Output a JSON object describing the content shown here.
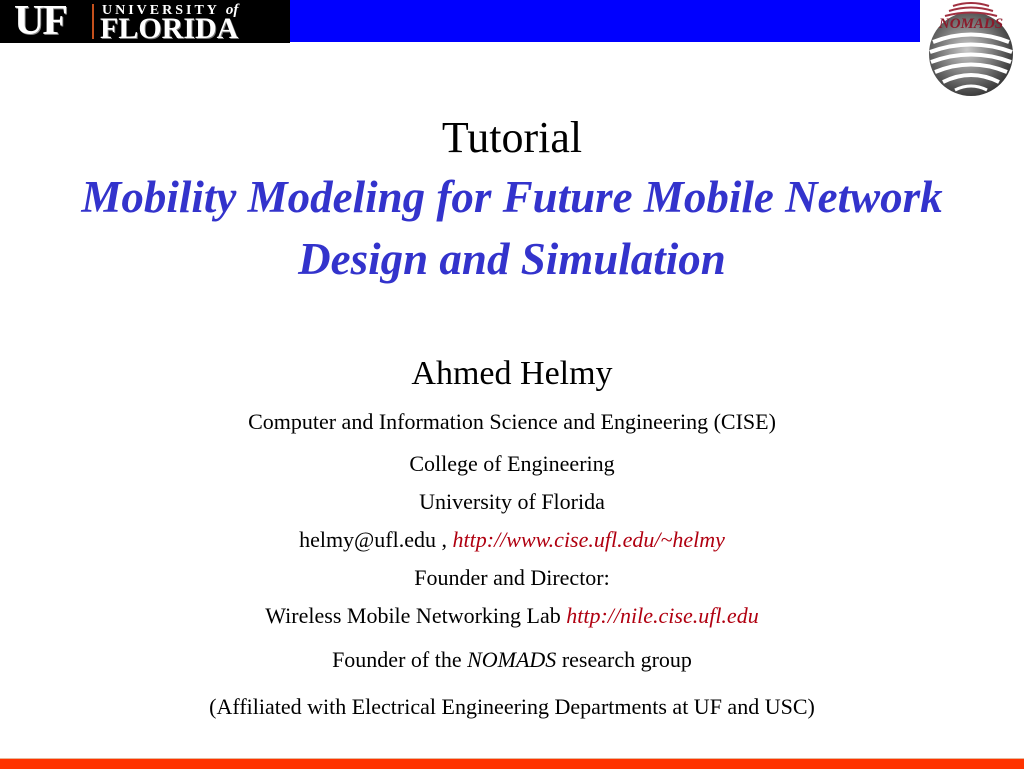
{
  "header": {
    "uf_logo": {
      "mark": "UF",
      "university": "UNIVERSITY",
      "of": "of",
      "florida": "FLORIDA"
    },
    "band_color": "#0000ff",
    "nomads_logo": {
      "text": "NOMADS"
    }
  },
  "title": {
    "main": "Tutorial",
    "subtitle_line1": "Mobility Modeling for Future Mobile Network",
    "subtitle_line2": "Design and Simulation",
    "subtitle_color": "#3333cc"
  },
  "author": {
    "name": "Ahmed Helmy",
    "department": "Computer and Information Science and Engineering (CISE)",
    "college": "College of Engineering",
    "university": "University of Florida",
    "email": "helmy@ufl.edu",
    "separator": " , ",
    "homepage": "http://www.cise.ufl.edu/~helmy",
    "role": "Founder and Director:",
    "lab_name": "Wireless Mobile Networking Lab ",
    "lab_url": "http://nile.cise.ufl.edu",
    "founder_prefix": "Founder of the ",
    "group_name": "NOMADS",
    "founder_suffix": " research group",
    "affiliation": "(Affiliated with Electrical Engineering Departments at UF and USC)",
    "link_color": "#b00010"
  },
  "footer": {
    "band_color": "#ff3300"
  }
}
